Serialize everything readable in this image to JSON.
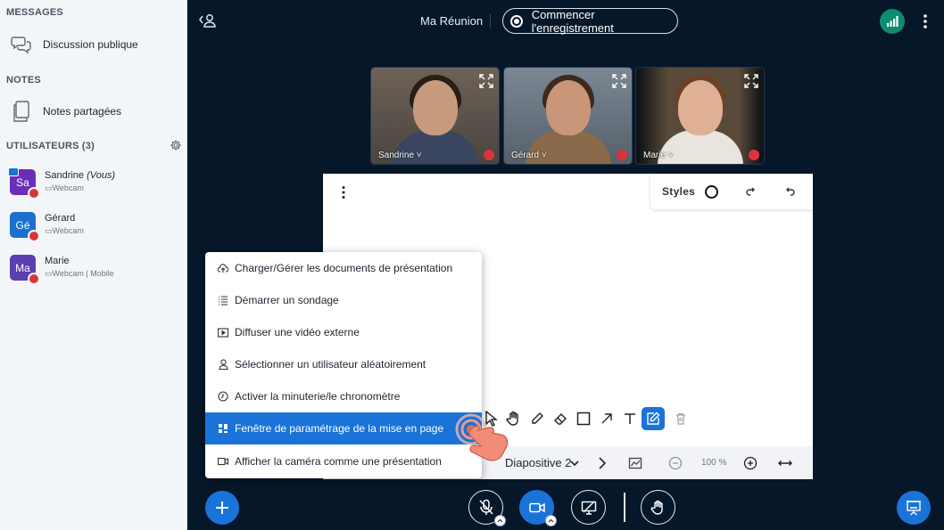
{
  "sidebar": {
    "messages_title": "MESSAGES",
    "public_chat": "Discussion publique",
    "notes_title": "NOTES",
    "shared_notes": "Notes partagées",
    "users_title": "UTILISATEURS (3)",
    "users": [
      {
        "initials": "Sa",
        "name": "Sandrine",
        "you": "(Vous)",
        "meta": "Webcam",
        "color": "#6a2fb8"
      },
      {
        "initials": "Gé",
        "name": "Gérard",
        "you": "",
        "meta": "Webcam",
        "color": "#1b6fd0"
      },
      {
        "initials": "Ma",
        "name": "Marie",
        "you": "",
        "meta": "Webcam | Mobile",
        "color": "#5b3fb0"
      }
    ]
  },
  "topbar": {
    "meeting_title": "Ma Réunion",
    "record_label": "Commencer l'enregistrement"
  },
  "videos": [
    {
      "name": "Sandrine"
    },
    {
      "name": "Gérard"
    },
    {
      "name": "Marie"
    }
  ],
  "whiteboard": {
    "styles_label": "Styles",
    "slide_label": "Diapositive 2",
    "zoom_label": "100 %"
  },
  "menu": {
    "items": [
      {
        "label": "Charger/Gérer les documents de présentation",
        "icon": "upload-cloud-icon"
      },
      {
        "label": "Démarrer un sondage",
        "icon": "poll-list-icon"
      },
      {
        "label": "Diffuser une vidéo externe",
        "icon": "external-video-icon"
      },
      {
        "label": "Sélectionner un utilisateur aléatoirement",
        "icon": "user-icon"
      },
      {
        "label": "Activer la minuterie/le chronomètre",
        "icon": "timer-icon"
      },
      {
        "label": "Fenêtre de paramétrage de la mise en page",
        "icon": "layout-grid-icon"
      },
      {
        "label": "Afficher la caméra comme une présentation",
        "icon": "camera-icon"
      }
    ],
    "selected_index": 5
  },
  "colors": {
    "accent": "#1a73d9",
    "background": "#06172a",
    "muted_red": "#d9343d",
    "connection_green": "#0f8c6e"
  }
}
